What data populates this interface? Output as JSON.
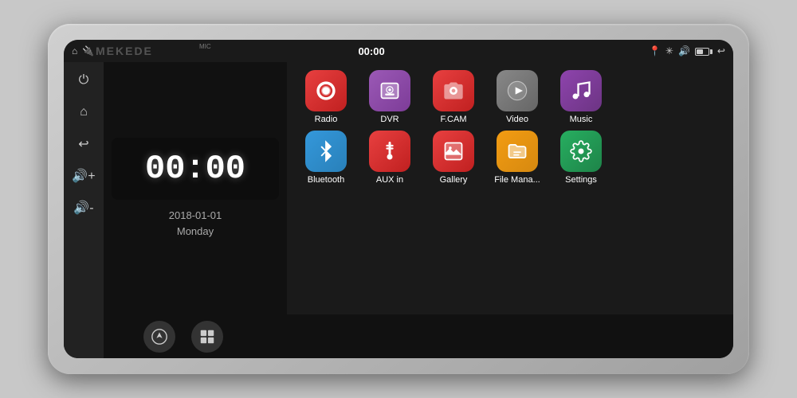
{
  "device": {
    "watermark": "MEKEDE"
  },
  "status_bar": {
    "time": "00:00",
    "mic_label": "MIC"
  },
  "clock_widget": {
    "time": "00:00",
    "date": "2018-01-01",
    "day": "Monday"
  },
  "apps": {
    "row1": [
      {
        "id": "radio",
        "label": "Radio",
        "color_class": "app-radio"
      },
      {
        "id": "dvr",
        "label": "DVR",
        "color_class": "app-dvr"
      },
      {
        "id": "fcam",
        "label": "F.CAM",
        "color_class": "app-fcam"
      },
      {
        "id": "video",
        "label": "Video",
        "color_class": "app-video"
      },
      {
        "id": "music",
        "label": "Music",
        "color_class": "app-music"
      }
    ],
    "row2": [
      {
        "id": "bluetooth",
        "label": "Bluetooth",
        "color_class": "app-bluetooth"
      },
      {
        "id": "aux",
        "label": "AUX in",
        "color_class": "app-aux"
      },
      {
        "id": "gallery",
        "label": "Gallery",
        "color_class": "app-gallery"
      },
      {
        "id": "filemanager",
        "label": "File Mana...",
        "color_class": "app-filemanager"
      },
      {
        "id": "settings",
        "label": "Settings",
        "color_class": "app-settings"
      }
    ]
  }
}
